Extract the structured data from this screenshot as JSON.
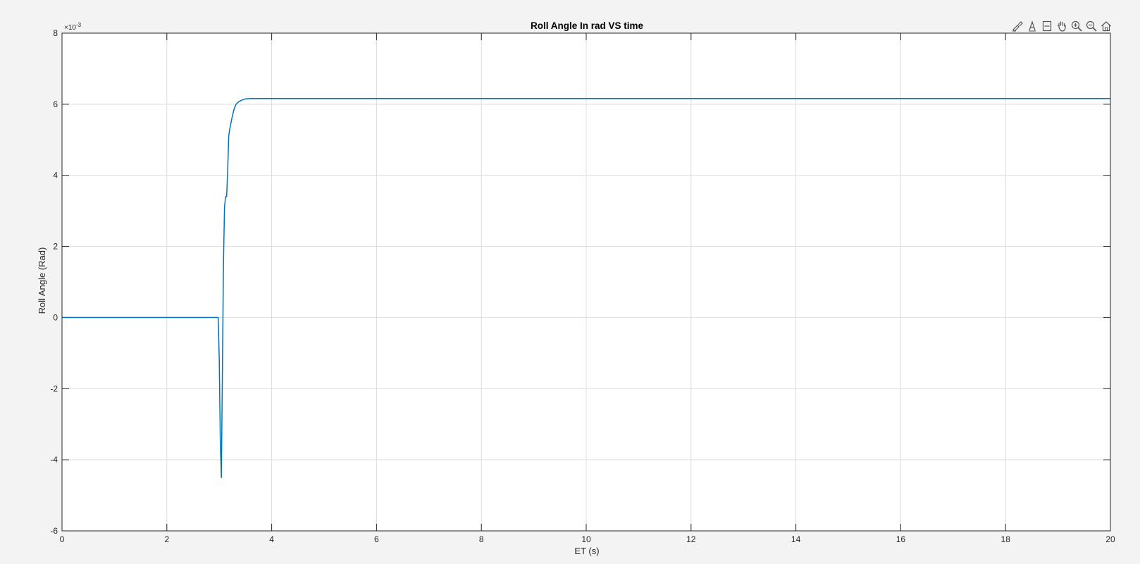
{
  "chart_data": {
    "type": "line",
    "title": "Roll Angle In rad VS time",
    "xlabel": "ET (s)",
    "ylabel": "Roll Angle (Rad)",
    "xlim": [
      0,
      20
    ],
    "ylim": [
      -6,
      8
    ],
    "xticks": [
      0,
      2,
      4,
      6,
      8,
      10,
      12,
      14,
      16,
      18,
      20
    ],
    "yticks": [
      -6,
      -4,
      -2,
      0,
      2,
      4,
      6,
      8
    ],
    "y_exponent_label": "×10",
    "y_exponent": "-3",
    "grid": true,
    "series": [
      {
        "color": "#0072bd",
        "x": [
          0,
          2.0,
          2.98,
          3.0,
          3.02,
          3.04,
          3.06,
          3.08,
          3.1,
          3.12,
          3.14,
          3.16,
          3.18,
          3.2,
          3.24,
          3.28,
          3.32,
          3.38,
          3.44,
          3.5,
          3.6,
          3.8,
          4.0,
          6.0,
          10.0,
          14.0,
          20.0
        ],
        "y": [
          0,
          0,
          0,
          -1.2,
          -3.5,
          -4.5,
          -1.5,
          1.5,
          3.1,
          3.4,
          3.4,
          4.1,
          5.1,
          5.3,
          5.6,
          5.85,
          6.0,
          6.08,
          6.12,
          6.15,
          6.16,
          6.16,
          6.16,
          6.16,
          6.16,
          6.16,
          6.16
        ]
      }
    ]
  },
  "toolbar": {
    "buttons": [
      {
        "name": "brush-icon"
      },
      {
        "name": "data-tips-icon"
      },
      {
        "name": "restore-view-icon"
      },
      {
        "name": "pan-hand-icon"
      },
      {
        "name": "zoom-in-icon"
      },
      {
        "name": "zoom-out-icon"
      },
      {
        "name": "home-icon"
      }
    ]
  }
}
